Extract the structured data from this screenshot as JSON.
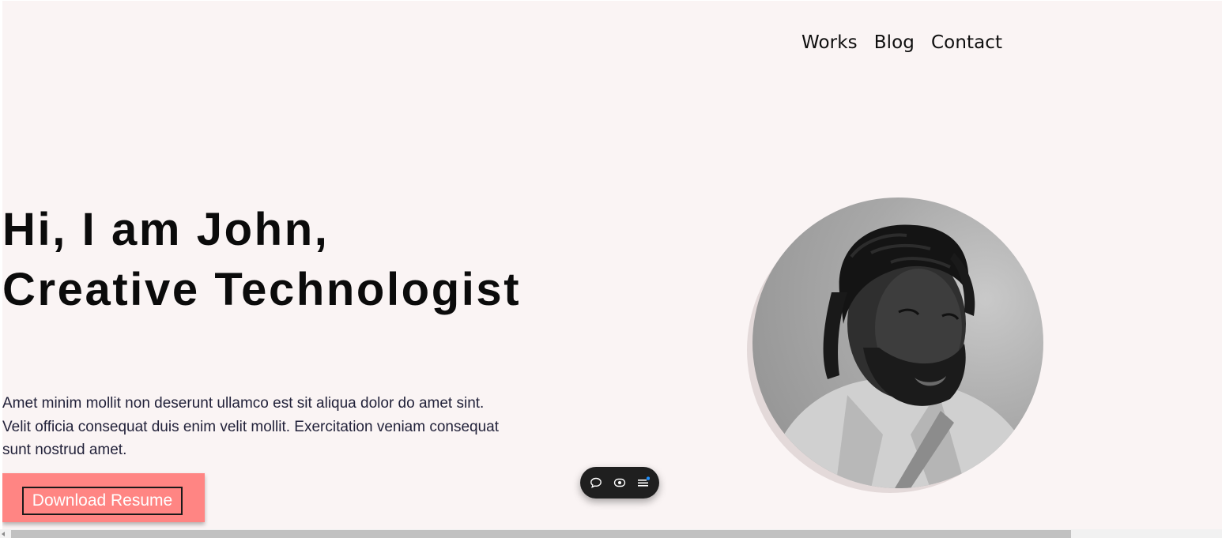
{
  "nav": {
    "items": [
      {
        "label": "Works"
      },
      {
        "label": "Blog"
      },
      {
        "label": "Contact"
      }
    ]
  },
  "hero": {
    "headline_line1": "Hi, I am John,",
    "headline_line2": "Creative Technologist",
    "intro": "Amet minim mollit non deserunt ullamco est sit aliqua dolor do amet sint. Velit officia consequat duis enim velit mollit. Exercitation veniam consequat sunt nostrud amet.",
    "cta_label": "Download Resume",
    "cta_color": "#ff8583",
    "background": "#faf4f4"
  },
  "toolbar": {
    "icons": [
      "comment-icon",
      "eye-icon",
      "menu-icon"
    ],
    "accent": "#1e90ff"
  }
}
